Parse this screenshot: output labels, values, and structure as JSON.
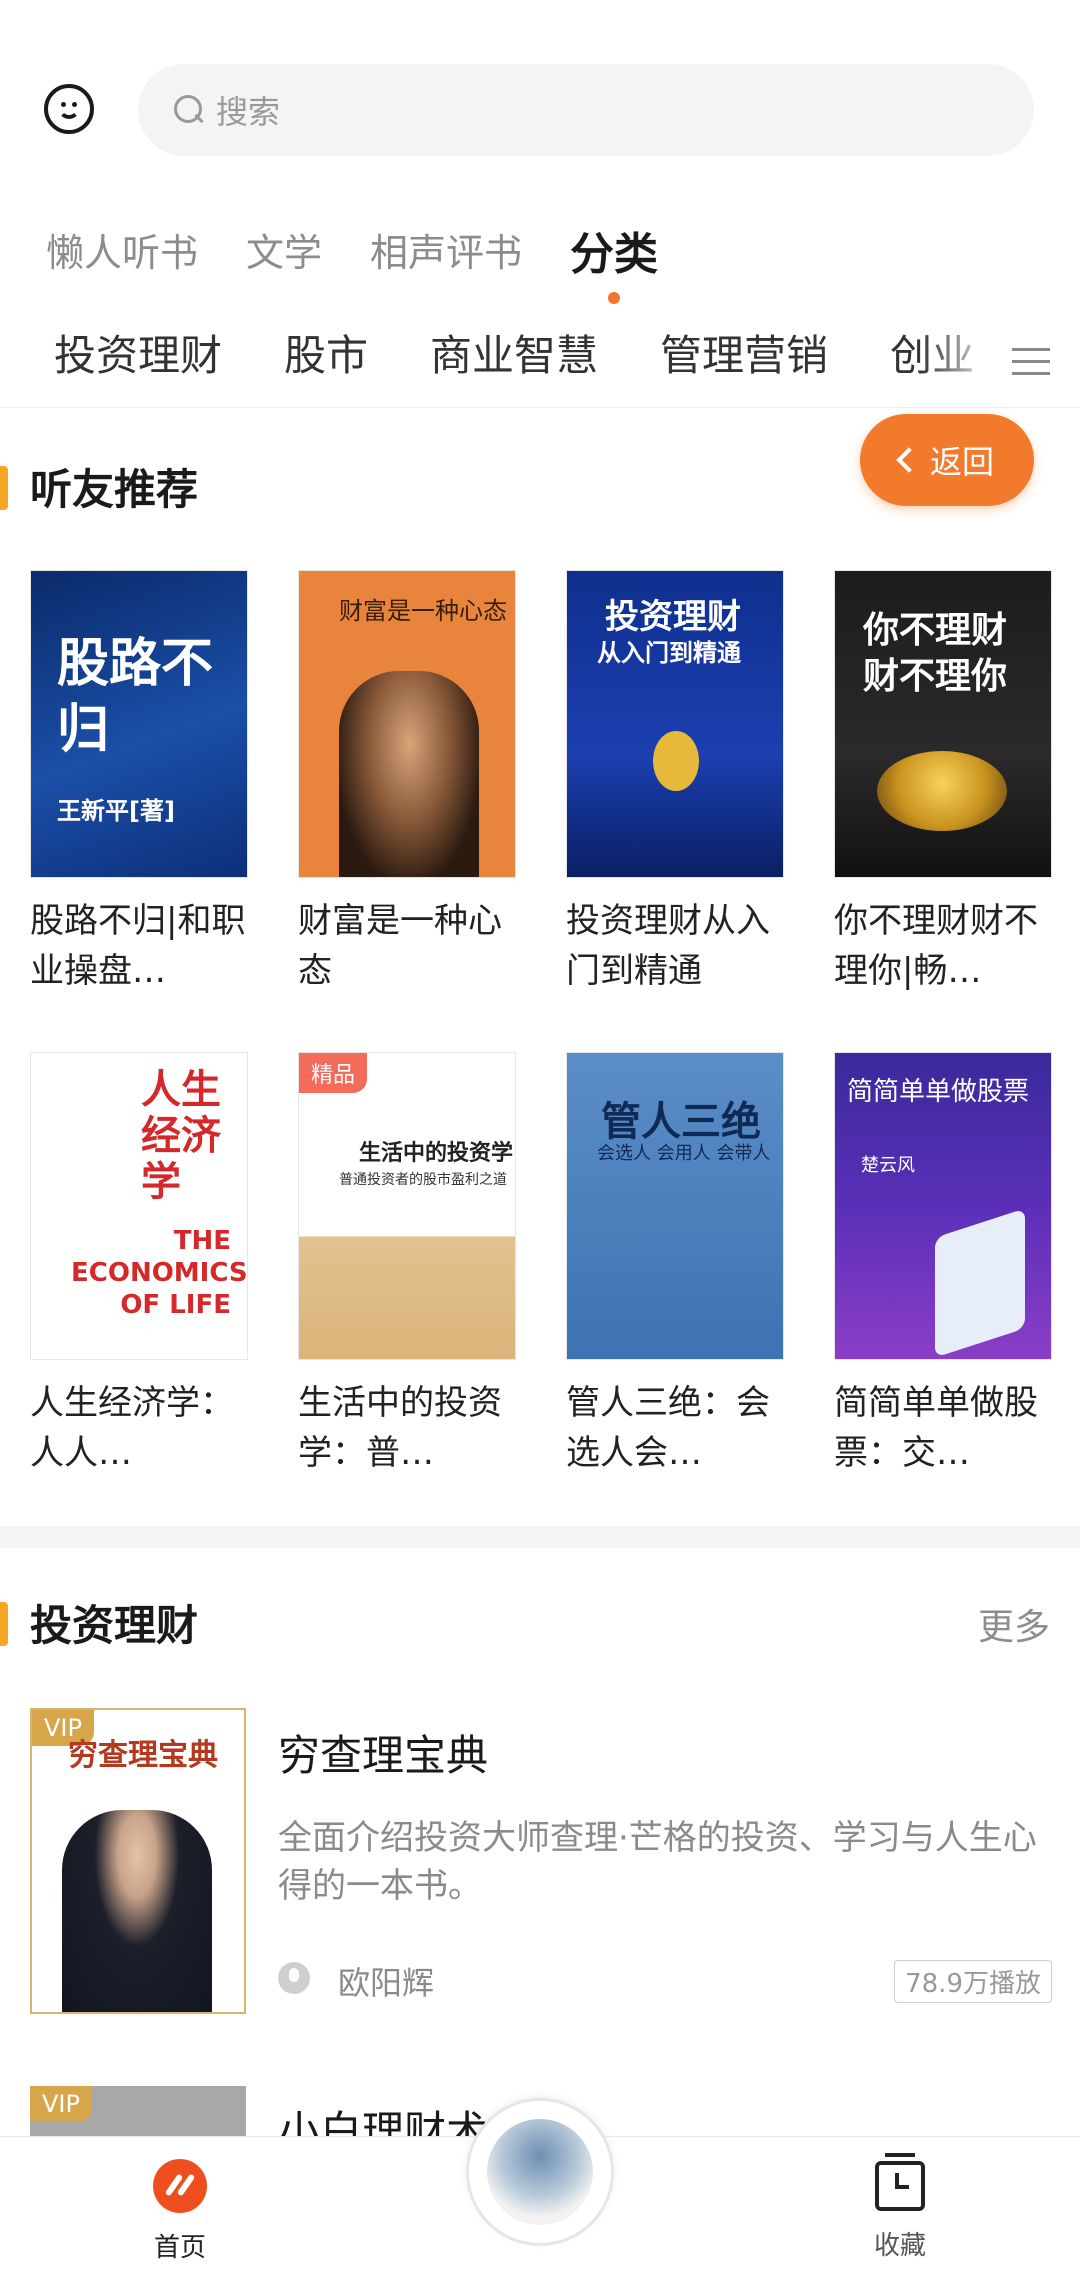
{
  "header": {
    "search_placeholder": "搜索"
  },
  "top_tabs": [
    {
      "label": "懒人听书",
      "active": false
    },
    {
      "label": "文学",
      "active": false
    },
    {
      "label": "相声评书",
      "active": false
    },
    {
      "label": "分类",
      "active": true
    }
  ],
  "categories": [
    "投资理财",
    "股市",
    "商业智慧",
    "管理营销",
    "创业"
  ],
  "recommend": {
    "title": "听友推荐",
    "back_label": "返回",
    "books": [
      {
        "title": "股路不归|和职业操盘…",
        "cover_text": "股路不归",
        "cover_author": "王新平[著]",
        "badge": ""
      },
      {
        "title": "财富是一种心态",
        "cover_text": "财富是一种心态",
        "cover_author": "",
        "badge": ""
      },
      {
        "title": "投资理财从入门到精通",
        "cover_text": "投资理财",
        "cover_author": "从入门到精通",
        "badge": ""
      },
      {
        "title": "你不理财财不理你|畅…",
        "cover_text": "你不理财",
        "cover_author": "财不理你",
        "badge": ""
      },
      {
        "title": "人生经济学：人人…",
        "cover_text": "人生经济学",
        "cover_author": "THE ECONOMICS OF LIFE",
        "badge": ""
      },
      {
        "title": "生活中的投资学：普…",
        "cover_text": "生活中的投资学",
        "cover_author": "普通投资者的股市盈利之道",
        "badge": "精品"
      },
      {
        "title": "管人三绝：会选人会…",
        "cover_text": "管人三绝",
        "cover_author": "会选人 会用人 会带人",
        "badge": ""
      },
      {
        "title": "简简单单做股票：交…",
        "cover_text": "简简单单做股票",
        "cover_author": "楚云风",
        "badge": ""
      }
    ]
  },
  "finance": {
    "title": "投资理财",
    "more_label": "更多",
    "items": [
      {
        "title": "穷查理宝典",
        "desc": "全面介绍投资大师查理·芒格的投资、学习与人生心得的一本书。",
        "author": "欧阳辉",
        "plays": "78.9万播放",
        "badge": "VIP",
        "cover_text": "穷查理宝典"
      },
      {
        "title": "小白理财术",
        "badge": "VIP"
      }
    ]
  },
  "bottom_nav": {
    "home_label": "首页",
    "fav_label": "收藏"
  },
  "colors": {
    "accent": "#f27a2c",
    "section_bar": "#f5a623",
    "home_icon": "#ef4f1f"
  }
}
